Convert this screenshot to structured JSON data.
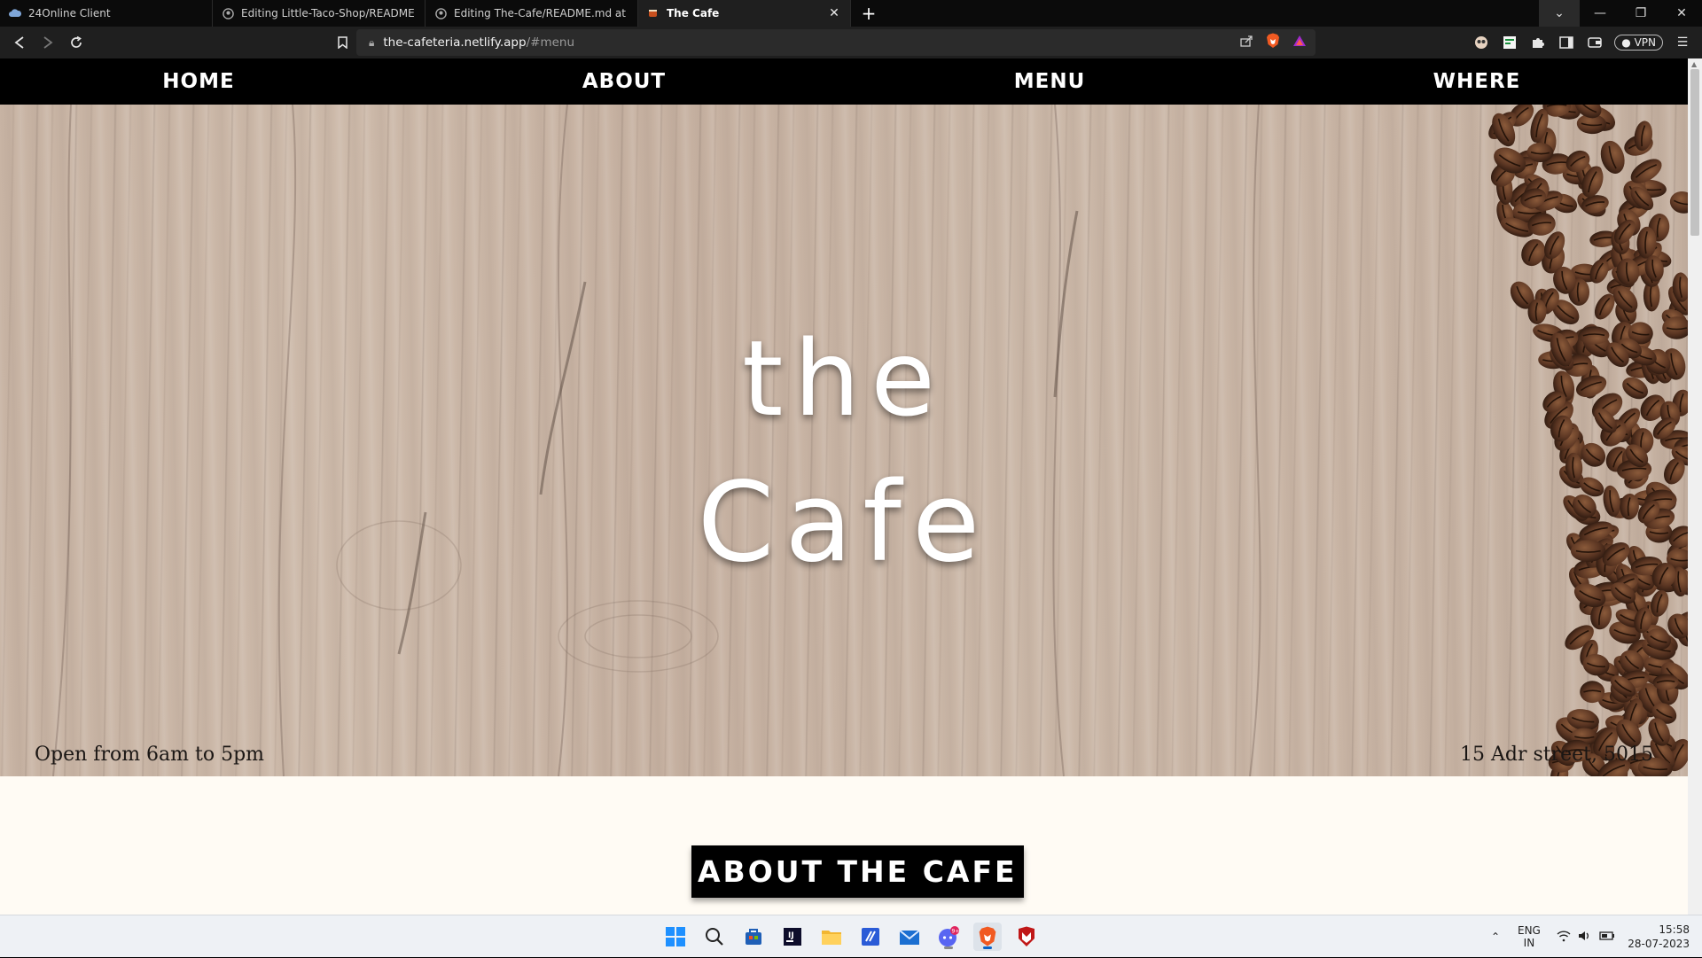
{
  "browser": {
    "tabs": [
      {
        "label": "24Online Client",
        "active": false,
        "icon": "cloud-icon"
      },
      {
        "label": "Editing Little-Taco-Shop/README.md",
        "active": false,
        "icon": "github-icon"
      },
      {
        "label": "Editing The-Cafe/README.md at main",
        "active": false,
        "icon": "github-icon"
      },
      {
        "label": "The Cafe",
        "active": true,
        "icon": "cafe-favicon-icon"
      }
    ],
    "new_tab_label": "+",
    "url": {
      "host": "the-cafeteria.netlify.app",
      "path": "/#menu"
    },
    "vpn_label": "VPN"
  },
  "site": {
    "nav": {
      "home": "HOME",
      "about": "ABOUT",
      "menu": "MENU",
      "where": "WHERE"
    },
    "hero": {
      "title_line1": "the",
      "title_line2": "Cafe",
      "hours": "Open from 6am to 5pm",
      "address": "15 Adr street, 5015"
    },
    "about_heading": "ABOUT THE CAFE"
  },
  "taskbar": {
    "lang_line1": "ENG",
    "lang_line2": "IN",
    "time": "15:58",
    "date": "28-07-2023",
    "notification_badge": "9+"
  },
  "colors": {
    "nav_bg": "#000000",
    "page_bg": "#fffbf4",
    "heading_bg": "#000000",
    "hero_text": "#ffffff"
  }
}
